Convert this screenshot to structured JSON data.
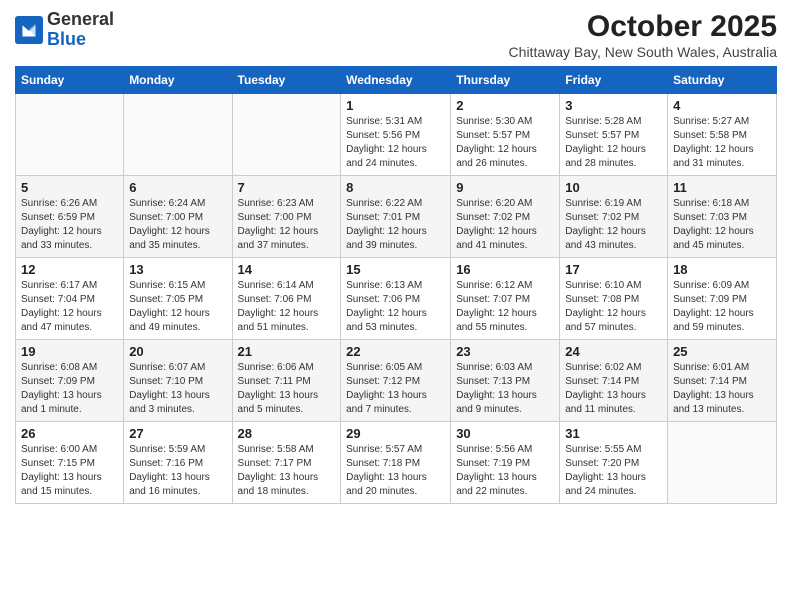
{
  "header": {
    "logo_general": "General",
    "logo_blue": "Blue",
    "month": "October 2025",
    "location": "Chittaway Bay, New South Wales, Australia"
  },
  "columns": [
    "Sunday",
    "Monday",
    "Tuesday",
    "Wednesday",
    "Thursday",
    "Friday",
    "Saturday"
  ],
  "weeks": [
    [
      {
        "day": "",
        "info": ""
      },
      {
        "day": "",
        "info": ""
      },
      {
        "day": "",
        "info": ""
      },
      {
        "day": "1",
        "info": "Sunrise: 5:31 AM\nSunset: 5:56 PM\nDaylight: 12 hours\nand 24 minutes."
      },
      {
        "day": "2",
        "info": "Sunrise: 5:30 AM\nSunset: 5:57 PM\nDaylight: 12 hours\nand 26 minutes."
      },
      {
        "day": "3",
        "info": "Sunrise: 5:28 AM\nSunset: 5:57 PM\nDaylight: 12 hours\nand 28 minutes."
      },
      {
        "day": "4",
        "info": "Sunrise: 5:27 AM\nSunset: 5:58 PM\nDaylight: 12 hours\nand 31 minutes."
      }
    ],
    [
      {
        "day": "5",
        "info": "Sunrise: 6:26 AM\nSunset: 6:59 PM\nDaylight: 12 hours\nand 33 minutes."
      },
      {
        "day": "6",
        "info": "Sunrise: 6:24 AM\nSunset: 7:00 PM\nDaylight: 12 hours\nand 35 minutes."
      },
      {
        "day": "7",
        "info": "Sunrise: 6:23 AM\nSunset: 7:00 PM\nDaylight: 12 hours\nand 37 minutes."
      },
      {
        "day": "8",
        "info": "Sunrise: 6:22 AM\nSunset: 7:01 PM\nDaylight: 12 hours\nand 39 minutes."
      },
      {
        "day": "9",
        "info": "Sunrise: 6:20 AM\nSunset: 7:02 PM\nDaylight: 12 hours\nand 41 minutes."
      },
      {
        "day": "10",
        "info": "Sunrise: 6:19 AM\nSunset: 7:02 PM\nDaylight: 12 hours\nand 43 minutes."
      },
      {
        "day": "11",
        "info": "Sunrise: 6:18 AM\nSunset: 7:03 PM\nDaylight: 12 hours\nand 45 minutes."
      }
    ],
    [
      {
        "day": "12",
        "info": "Sunrise: 6:17 AM\nSunset: 7:04 PM\nDaylight: 12 hours\nand 47 minutes."
      },
      {
        "day": "13",
        "info": "Sunrise: 6:15 AM\nSunset: 7:05 PM\nDaylight: 12 hours\nand 49 minutes."
      },
      {
        "day": "14",
        "info": "Sunrise: 6:14 AM\nSunset: 7:06 PM\nDaylight: 12 hours\nand 51 minutes."
      },
      {
        "day": "15",
        "info": "Sunrise: 6:13 AM\nSunset: 7:06 PM\nDaylight: 12 hours\nand 53 minutes."
      },
      {
        "day": "16",
        "info": "Sunrise: 6:12 AM\nSunset: 7:07 PM\nDaylight: 12 hours\nand 55 minutes."
      },
      {
        "day": "17",
        "info": "Sunrise: 6:10 AM\nSunset: 7:08 PM\nDaylight: 12 hours\nand 57 minutes."
      },
      {
        "day": "18",
        "info": "Sunrise: 6:09 AM\nSunset: 7:09 PM\nDaylight: 12 hours\nand 59 minutes."
      }
    ],
    [
      {
        "day": "19",
        "info": "Sunrise: 6:08 AM\nSunset: 7:09 PM\nDaylight: 13 hours\nand 1 minute."
      },
      {
        "day": "20",
        "info": "Sunrise: 6:07 AM\nSunset: 7:10 PM\nDaylight: 13 hours\nand 3 minutes."
      },
      {
        "day": "21",
        "info": "Sunrise: 6:06 AM\nSunset: 7:11 PM\nDaylight: 13 hours\nand 5 minutes."
      },
      {
        "day": "22",
        "info": "Sunrise: 6:05 AM\nSunset: 7:12 PM\nDaylight: 13 hours\nand 7 minutes."
      },
      {
        "day": "23",
        "info": "Sunrise: 6:03 AM\nSunset: 7:13 PM\nDaylight: 13 hours\nand 9 minutes."
      },
      {
        "day": "24",
        "info": "Sunrise: 6:02 AM\nSunset: 7:14 PM\nDaylight: 13 hours\nand 11 minutes."
      },
      {
        "day": "25",
        "info": "Sunrise: 6:01 AM\nSunset: 7:14 PM\nDaylight: 13 hours\nand 13 minutes."
      }
    ],
    [
      {
        "day": "26",
        "info": "Sunrise: 6:00 AM\nSunset: 7:15 PM\nDaylight: 13 hours\nand 15 minutes."
      },
      {
        "day": "27",
        "info": "Sunrise: 5:59 AM\nSunset: 7:16 PM\nDaylight: 13 hours\nand 16 minutes."
      },
      {
        "day": "28",
        "info": "Sunrise: 5:58 AM\nSunset: 7:17 PM\nDaylight: 13 hours\nand 18 minutes."
      },
      {
        "day": "29",
        "info": "Sunrise: 5:57 AM\nSunset: 7:18 PM\nDaylight: 13 hours\nand 20 minutes."
      },
      {
        "day": "30",
        "info": "Sunrise: 5:56 AM\nSunset: 7:19 PM\nDaylight: 13 hours\nand 22 minutes."
      },
      {
        "day": "31",
        "info": "Sunrise: 5:55 AM\nSunset: 7:20 PM\nDaylight: 13 hours\nand 24 minutes."
      },
      {
        "day": "",
        "info": ""
      }
    ]
  ]
}
